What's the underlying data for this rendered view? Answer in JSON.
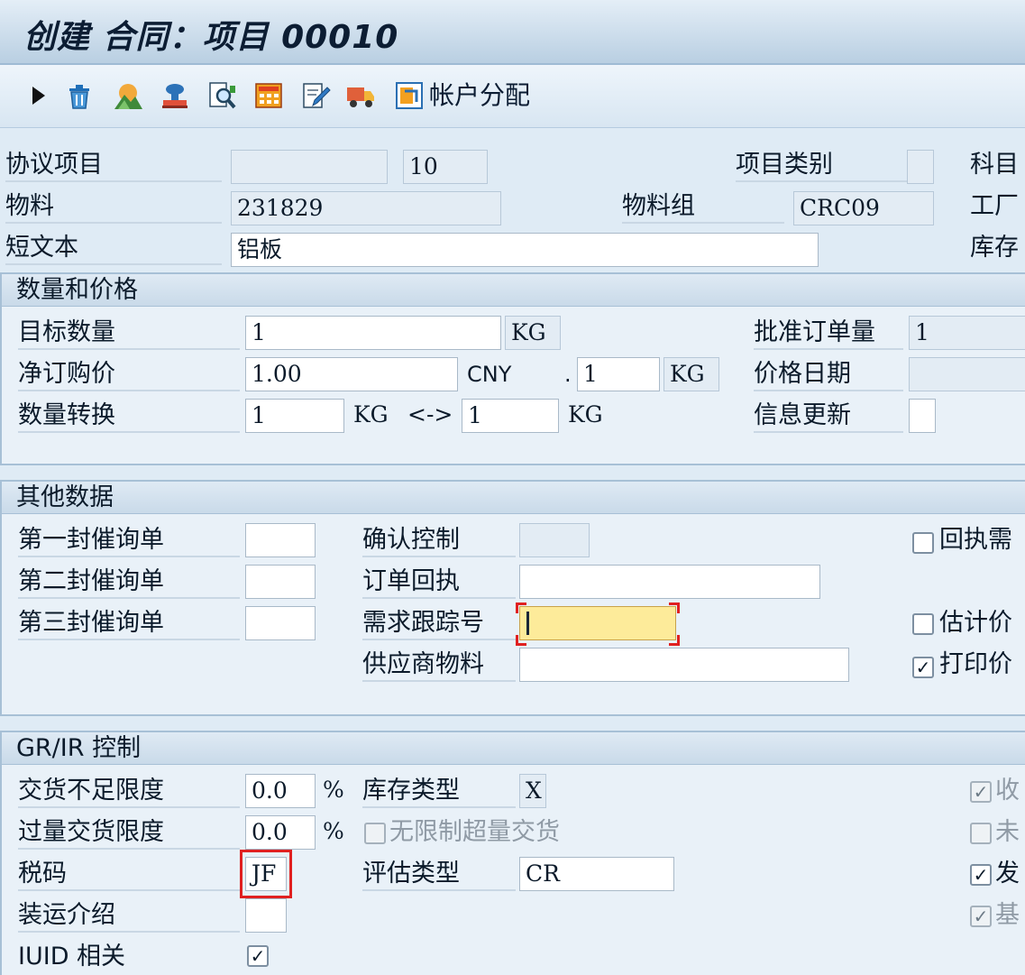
{
  "window": {
    "title": "创建 合同：项目 00010"
  },
  "toolbar": {
    "icons": [
      "expand-arrow-icon",
      "delete-icon",
      "mountain-icon",
      "stamp-icon",
      "search-document-icon",
      "calculator-icon",
      "edit-document-icon",
      "delivery-truck-icon",
      "account-assignment-icon"
    ],
    "account_assignment_label": "帐户分配"
  },
  "header": {
    "agreement_item_label": "协议项目",
    "agreement_item_value": "",
    "item_number": "10",
    "item_category_label": "项目类别",
    "item_category_value": "",
    "subject_label": "科目",
    "material_label": "物料",
    "material_value": "231829",
    "material_group_label": "物料组",
    "material_group_value": "CRC09",
    "plant_label": "工厂",
    "short_text_label": "短文本",
    "short_text_value": "铝板",
    "storage_label": "库存"
  },
  "qty_price": {
    "title": "数量和价格",
    "target_qty_label": "目标数量",
    "target_qty_value": "1",
    "target_qty_unit": "KG",
    "approved_order_qty_label": "批准订单量",
    "approved_order_qty_value": "1",
    "net_price_label": "净订购价",
    "net_price_value": "1.00",
    "currency": "CNY",
    "per_sep": ".",
    "price_unit_value": "1",
    "price_unit_uom": "KG",
    "price_date_label": "价格日期",
    "price_date_value": "",
    "conversion_label": "数量转换",
    "conversion_left": "1",
    "conversion_left_unit": "KG",
    "conversion_arrow": "<->",
    "conversion_right": "1",
    "conversion_right_unit": "KG",
    "info_update_label": "信息更新",
    "info_update_value": ""
  },
  "other_data": {
    "title": "其他数据",
    "reminder1_label": "第一封催询单",
    "reminder2_label": "第二封催询单",
    "reminder3_label": "第三封催询单",
    "confirmation_control_label": "确认控制",
    "order_ack_label": "订单回执",
    "tracking_no_label": "需求跟踪号",
    "tracking_no_value": "",
    "vendor_material_label": "供应商物料",
    "ack_required_label": "回执需",
    "ack_required_checked": false,
    "estimated_price_label": "估计价",
    "estimated_price_checked": false,
    "print_price_label": "打印价",
    "print_price_checked": true
  },
  "grir": {
    "title": "GR/IR 控制",
    "underdelivery_label": "交货不足限度",
    "underdelivery_value": "0.0",
    "underdelivery_unit": "%",
    "overdelivery_label": "过量交货限度",
    "overdelivery_value": "0.0",
    "overdelivery_unit": "%",
    "stock_type_label": "库存类型",
    "stock_type_value": "X",
    "unlimited_overdelivery_label": "无限制超量交货",
    "unlimited_overdelivery_checked": false,
    "tax_code_label": "税码",
    "tax_code_value": "JF",
    "valuation_type_label": "评估类型",
    "valuation_type_value": "CR",
    "shipping_instr_label": "装运介绍",
    "shipping_instr_value": "",
    "iuid_label": "IUID 相关",
    "iuid_checked": true,
    "right_checks": [
      {
        "label": "收",
        "checked": true,
        "disabled": true
      },
      {
        "label": "未",
        "checked": false,
        "disabled": true
      },
      {
        "label": "发",
        "checked": true,
        "disabled": false
      },
      {
        "label": "基",
        "checked": true,
        "disabled": true
      }
    ]
  },
  "colors": {
    "highlight_field": "#fdeb9a",
    "red_marker": "#e02020",
    "background": "#dfebf5"
  }
}
